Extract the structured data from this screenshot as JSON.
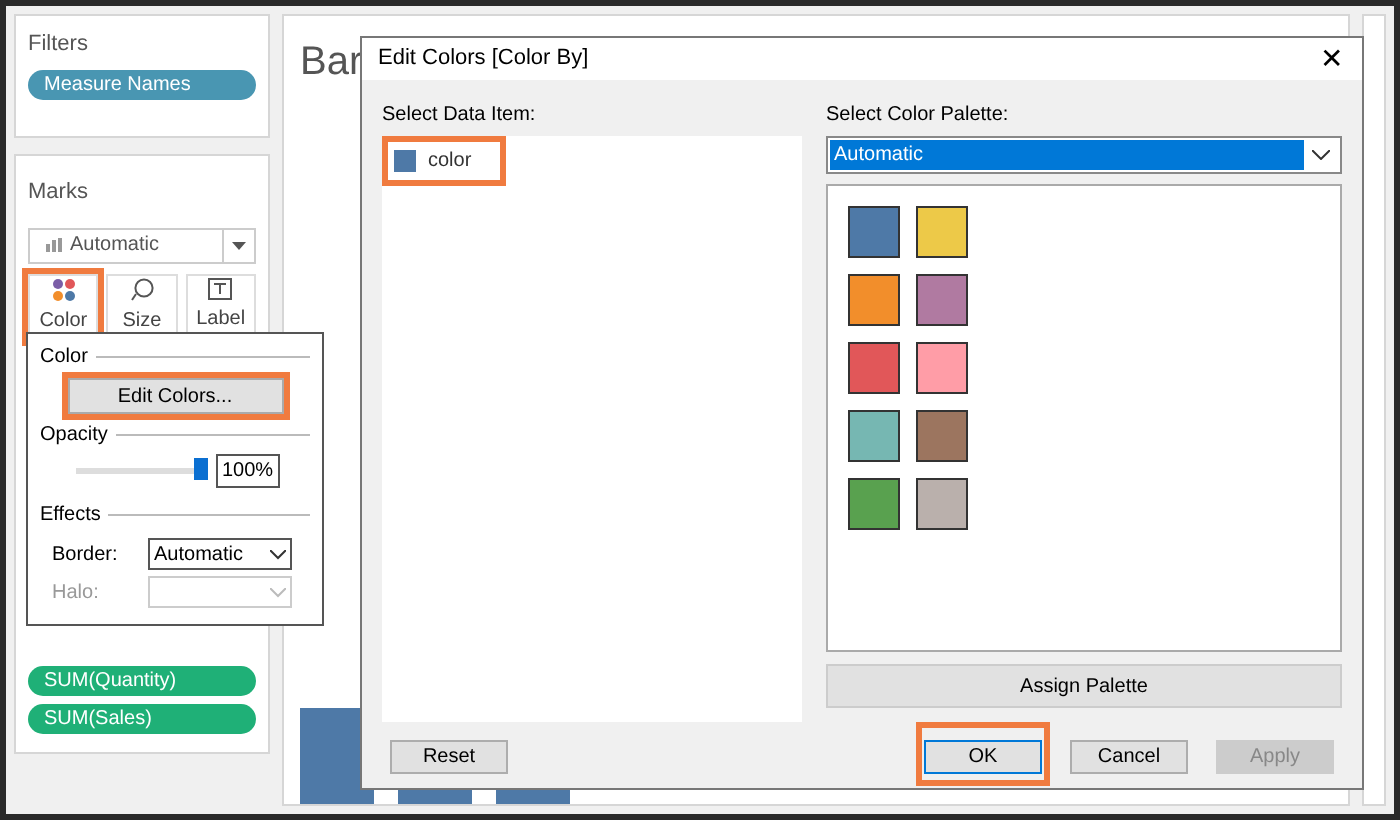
{
  "filters": {
    "title": "Filters",
    "pills": [
      {
        "label": "Measure Names",
        "color": "#4996b2"
      }
    ]
  },
  "marks": {
    "title": "Marks",
    "mark_type": "Automatic",
    "cards": [
      {
        "label": "Color",
        "highlighted": true
      },
      {
        "label": "Size",
        "highlighted": false
      },
      {
        "label": "Label",
        "highlighted": false
      }
    ],
    "pills": [
      {
        "label": "SUM(Quantity)",
        "color": "#1fb077"
      },
      {
        "label": "SUM(Sales)",
        "color": "#1fb077"
      }
    ]
  },
  "sheet": {
    "title": "Bar"
  },
  "color_popup": {
    "color_heading": "Color",
    "edit_button": {
      "label": "Edit Colors...",
      "highlighted": true
    },
    "opacity_heading": "Opacity",
    "opacity": {
      "level": 1.0,
      "reading": "100%"
    },
    "effects_heading": "Effects",
    "border": {
      "label": "Border:",
      "value": "Automatic",
      "disabled": false
    },
    "halo": {
      "label": "Halo:",
      "disabled": true
    }
  },
  "dialog": {
    "title": "Edit Colors [Color By]",
    "close": "✕",
    "data_label": "Select Data Item:",
    "data_items": [
      {
        "label": "color",
        "color": "#4e79a7",
        "highlighted": true
      }
    ],
    "palette_label": "Select Color Palette:",
    "palette": "Automatic",
    "swatches": [
      {
        "color": "#4e79a7"
      },
      {
        "color": "#edc948"
      },
      {
        "color": "#f28e2b"
      },
      {
        "color": "#b07aa1"
      },
      {
        "color": "#e15759"
      },
      {
        "color": "#ff9da7"
      },
      {
        "color": "#76b7b2"
      },
      {
        "color": "#9c755f"
      },
      {
        "color": "#59a14f"
      },
      {
        "color": "#bab0ac"
      }
    ],
    "assign_button": "Assign Palette",
    "buttons": [
      {
        "label": "Reset",
        "kind": "left",
        "highlighted": false,
        "disabled": false
      },
      {
        "label": "OK",
        "kind": "right",
        "highlighted": true,
        "disabled": false
      },
      {
        "label": "Cancel",
        "kind": "right",
        "highlighted": false,
        "disabled": false
      },
      {
        "label": "Apply",
        "kind": "right",
        "highlighted": false,
        "disabled": true
      }
    ]
  }
}
